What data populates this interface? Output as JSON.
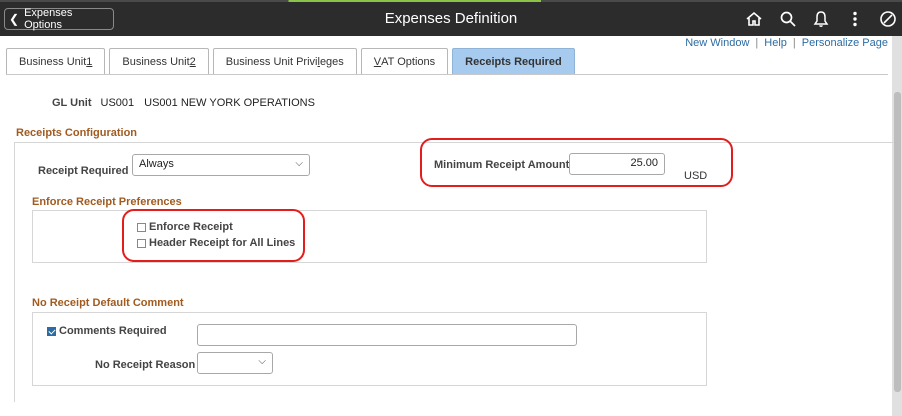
{
  "header": {
    "back_label": "Expenses Options",
    "title": "Expenses Definition",
    "icons": [
      "home-icon",
      "search-icon",
      "bell-icon",
      "more-vertical-icon",
      "nav-circle-icon"
    ]
  },
  "toplinks": {
    "new_window": "New Window",
    "help": "Help",
    "personalize": "Personalize Page"
  },
  "tabs": [
    {
      "label": "Business Unit 1",
      "active": false
    },
    {
      "label": "Business Unit 2",
      "active": false
    },
    {
      "label": "Business Unit Privileges",
      "active": false
    },
    {
      "label": "VAT Options",
      "active": false
    },
    {
      "label": "Receipts Required",
      "active": true
    }
  ],
  "gl_unit": {
    "label": "GL Unit",
    "code": "US001",
    "description": "US001 NEW YORK OPERATIONS"
  },
  "receipts_config": {
    "section_title": "Receipts Configuration",
    "receipt_required_label": "Receipt Required",
    "receipt_required_value": "Always",
    "min_amount_label": "Minimum Receipt Amount",
    "min_amount_value": "25.00",
    "currency": "USD"
  },
  "enforce_prefs": {
    "section_title": "Enforce Receipt Preferences",
    "enforce_receipt_label": "Enforce Receipt",
    "enforce_receipt_checked": false,
    "header_receipt_label": "Header Receipt for All Lines",
    "header_receipt_checked": false
  },
  "no_receipt": {
    "section_title": "No Receipt Default Comment",
    "comments_required_label": "Comments Required",
    "comments_required_checked": true,
    "comments_value": "",
    "reason_label": "No Receipt Reason",
    "reason_value": ""
  },
  "colors": {
    "header_bg": "#2c2c2c",
    "active_tab": "#a7cbee",
    "section_title": "#a15b20",
    "highlight": "#e41c1c",
    "link": "#2d6ca2"
  }
}
